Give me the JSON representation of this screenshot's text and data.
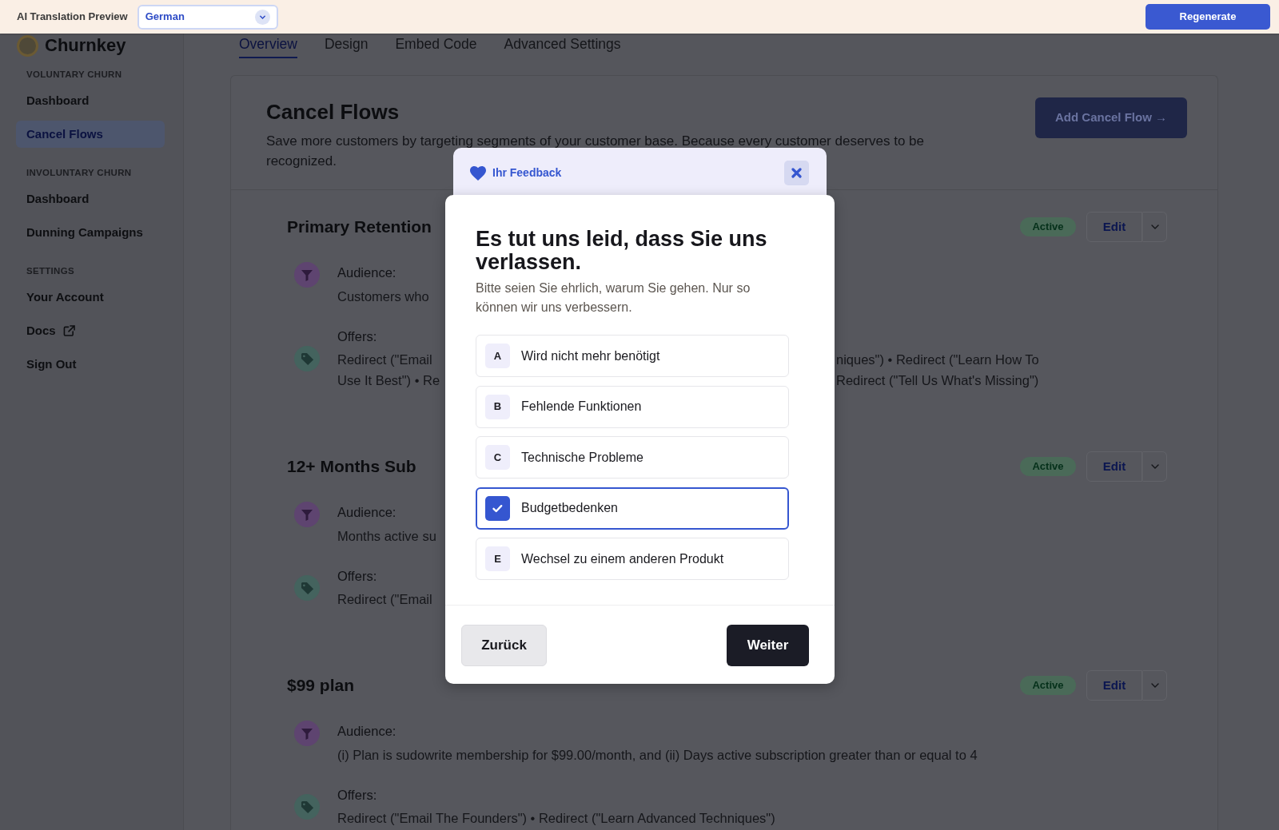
{
  "translation_bar": {
    "label": "AI Translation Preview",
    "language": "German",
    "regenerate_button": "Regenerate"
  },
  "header": {
    "logo": "Churnkey",
    "tabs": [
      {
        "label": "Overview",
        "selected": true
      },
      {
        "label": "Design",
        "selected": false
      },
      {
        "label": "Embed Code",
        "selected": false
      },
      {
        "label": "Advanced Settings",
        "selected": false
      }
    ]
  },
  "sidebar": {
    "sections": [
      {
        "heading": "VOLUNTARY CHURN",
        "items": [
          {
            "label": "Dashboard",
            "selected": false
          },
          {
            "label": "Cancel Flows",
            "selected": true
          }
        ]
      },
      {
        "heading": "INVOLUNTARY CHURN",
        "items": [
          {
            "label": "Dashboard",
            "selected": false
          },
          {
            "label": "Dunning Campaigns",
            "selected": false
          }
        ]
      },
      {
        "heading": "SETTINGS",
        "items": [
          {
            "label": "Your Account",
            "selected": false
          },
          {
            "label": "Docs",
            "selected": false,
            "external": true
          },
          {
            "label": "Sign Out",
            "selected": false
          }
        ]
      }
    ]
  },
  "page": {
    "title": "Cancel Flows",
    "description_lines": [
      "Save more customers by targeting segments of your customer base. Because every customer deserves to be",
      "recognized."
    ],
    "add_button": "Add Cancel Flow →"
  },
  "flows": [
    {
      "name": "Primary Retention",
      "status": "Active",
      "edit_button": "Edit",
      "audience": {
        "label": "Audience:",
        "lines": [
          "Customers who"
        ]
      },
      "offers": {
        "label": "Offers:",
        "lines": [
          "Redirect (\"Email",
          "Use It Best\") • Re"
        ],
        "lines_right_of_dialog": [
          "niques\") • Redirect (\"Learn How To",
          "Redirect (\"Tell Us What's Missing\")"
        ]
      }
    },
    {
      "name": "12+ Months Sub",
      "status": "Active",
      "edit_button": "Edit",
      "audience": {
        "label": "Audience:",
        "lines": [
          "Months active su"
        ]
      },
      "offers": {
        "label": "Offers:",
        "lines": [
          "Redirect (\"Email"
        ]
      }
    },
    {
      "name": "$99 plan",
      "status": "Active",
      "edit_button": "Edit",
      "audience": {
        "label": "Audience:",
        "lines": [
          "(i) Plan is sudowrite membership for $99.00/month, and (ii) Days active subscription greater than or equal to 4"
        ]
      },
      "offers": {
        "label": "Offers:",
        "lines": [
          "Redirect (\"Email The Founders\") • Redirect (\"Learn Advanced Techniques\")"
        ]
      }
    }
  ],
  "dialog": {
    "header": "Ihr Feedback",
    "title": "Es tut uns leid, dass Sie uns verlassen.",
    "subtitle": "Bitte seien Sie ehrlich, warum Sie gehen. Nur so können wir uns verbessern.",
    "options": [
      {
        "letter": "A",
        "label": "Wird nicht mehr benötigt",
        "selected": false
      },
      {
        "letter": "B",
        "label": "Fehlende Funktionen",
        "selected": false
      },
      {
        "letter": "C",
        "label": "Technische Probleme",
        "selected": false
      },
      {
        "label": "Budgetbedenken",
        "selected": true
      },
      {
        "letter": "E",
        "label": "Wechsel zu einem anderen Produkt",
        "selected": false
      }
    ],
    "back_button": "Zurück",
    "next_button": "Weiter"
  }
}
